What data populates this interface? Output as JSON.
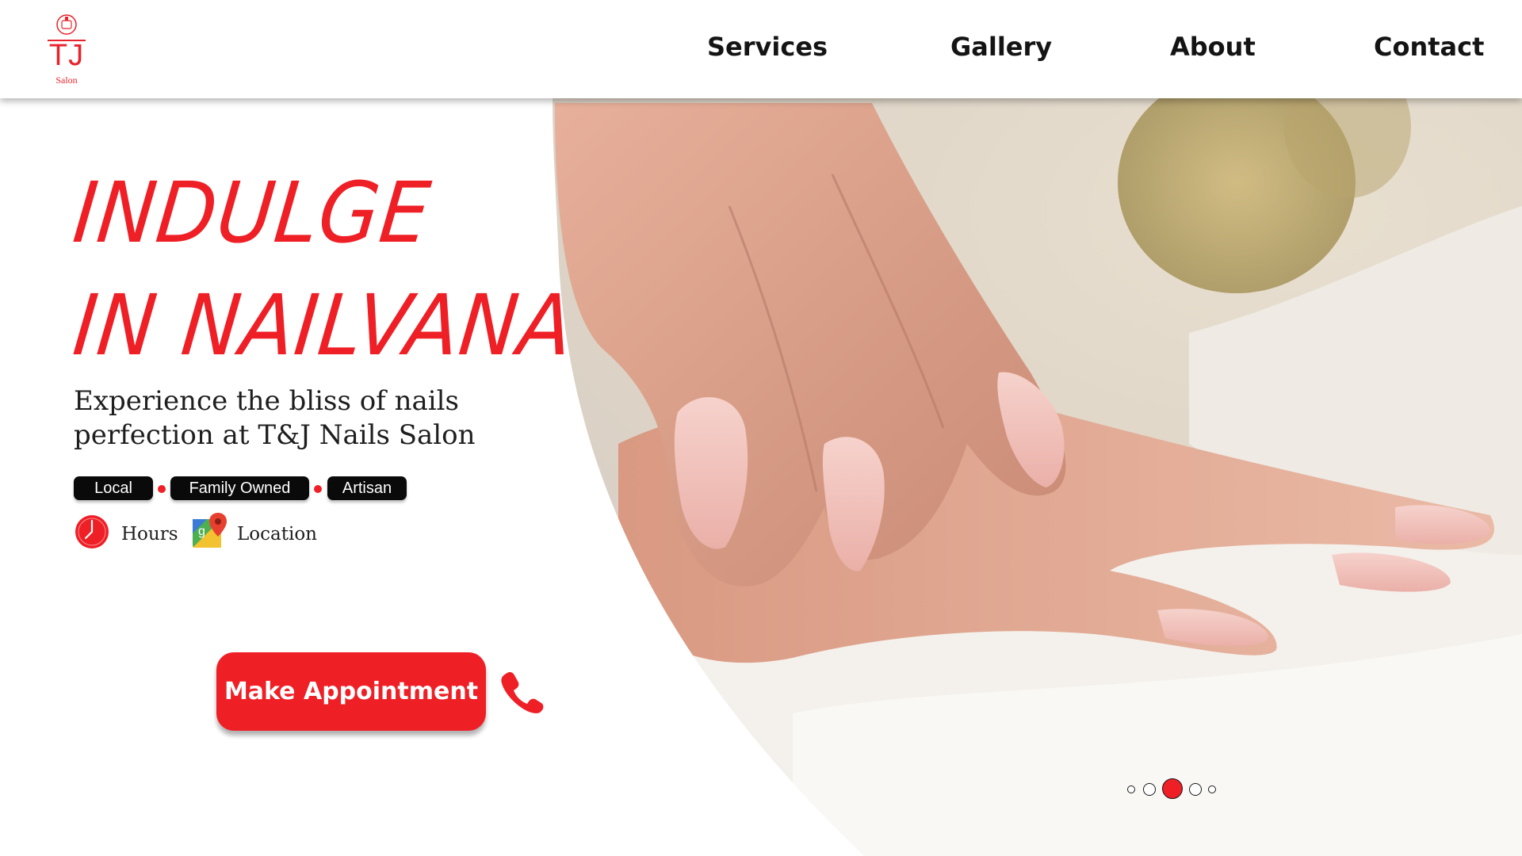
{
  "brand": {
    "logo_text": "TJ",
    "logo_subtext": "Salon",
    "accent_color": "#ef1f26"
  },
  "nav": {
    "items": [
      {
        "label": "Services"
      },
      {
        "label": "Gallery"
      },
      {
        "label": "About"
      },
      {
        "label": "Contact"
      }
    ]
  },
  "hero": {
    "headline_line1": "INDULGE",
    "headline_line2": "IN NAILVANA",
    "tagline_line1": "Experience the bliss of nails",
    "tagline_line2": "perfection at T&J Nails Salon",
    "badges": [
      "Local",
      "Family Owned",
      "Artisan"
    ],
    "hours_label": "Hours",
    "hours_icon": "clock-icon",
    "location_label": "Location",
    "location_icon": "map-pin-icon",
    "cta_label": "Make Appointment",
    "phone_icon": "phone-icon",
    "image_subject": "manicured hands on white fur"
  },
  "carousel": {
    "slide_count": 5,
    "active_index": 2
  }
}
